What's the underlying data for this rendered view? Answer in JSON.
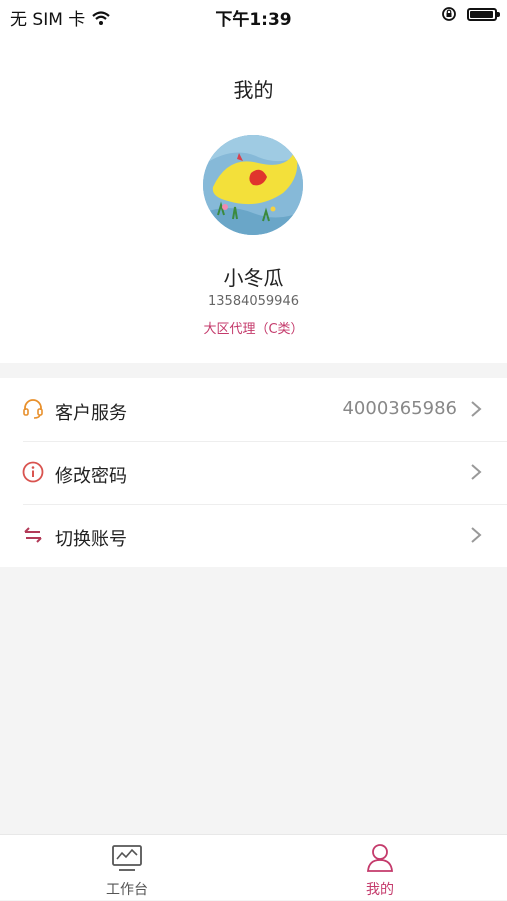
{
  "status_bar": {
    "carrier": "无 SIM 卡",
    "time": "下午1:39",
    "battery_level": 0.95
  },
  "page": {
    "title": "我的"
  },
  "profile": {
    "name": "小冬瓜",
    "phone": "13584059946",
    "role": "大区代理（C类）"
  },
  "menu": {
    "customer_service": {
      "label": "客户服务",
      "value": "4000365986",
      "icon": "headset-icon"
    },
    "change_password": {
      "label": "修改密码",
      "icon": "info-icon"
    },
    "switch_account": {
      "label": "切换账号",
      "icon": "swap-icon"
    }
  },
  "tabbar": {
    "workbench": {
      "label": "工作台",
      "icon": "chart-monitor-icon",
      "active": false
    },
    "mine": {
      "label": "我的",
      "icon": "user-icon",
      "active": true
    }
  },
  "colors": {
    "accent": "#c43a6b",
    "tab_active": "#c43a6b",
    "tab_inactive": "#555555",
    "icon_orange": "#e8902c",
    "icon_red": "#d9534f"
  }
}
